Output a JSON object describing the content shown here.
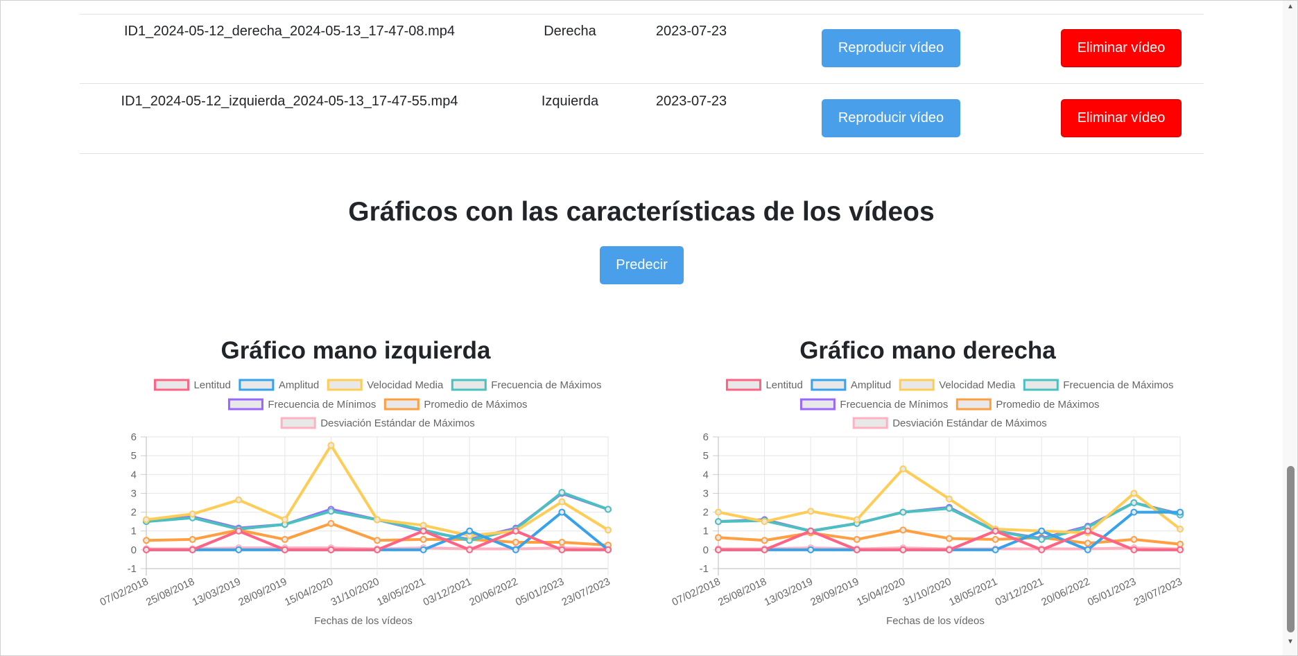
{
  "table": {
    "rows": [
      {
        "file": "ID1_2024-05-12_derecha_2024-05-13_17-47-08.mp4",
        "hand": "Derecha",
        "date": "2023-07-23",
        "play_label": "Reproducir vídeo",
        "delete_label": "Eliminar vídeo"
      },
      {
        "file": "ID1_2024-05-12_izquierda_2024-05-13_17-47-55.mp4",
        "hand": "Izquierda",
        "date": "2023-07-23",
        "play_label": "Reproducir vídeo",
        "delete_label": "Eliminar vídeo"
      }
    ]
  },
  "section": {
    "title": "Gráficos con las características de los vídeos",
    "predict_label": "Predecir"
  },
  "colors": {
    "play_button": "#4a9fea",
    "delete_button": "#ff0000"
  },
  "chart_data": [
    {
      "type": "line",
      "title": "Gráfico mano izquierda",
      "xlabel": "Fechas de los vídeos",
      "ylabel": "",
      "ylim": [
        -1,
        6
      ],
      "yticks": [
        -1,
        0,
        1,
        2,
        3,
        4,
        5,
        6
      ],
      "grid": true,
      "legend_position": "top",
      "categories": [
        "07/02/2018",
        "25/08/2018",
        "13/03/2019",
        "28/09/2019",
        "15/04/2020",
        "31/10/2020",
        "18/05/2021",
        "03/12/2021",
        "20/06/2022",
        "05/01/2023",
        "23/07/2023"
      ],
      "series": [
        {
          "name": "Lentitud",
          "color": "#ff6384",
          "values": [
            0,
            0,
            1,
            0,
            0,
            0,
            1,
            0,
            1,
            0,
            0
          ]
        },
        {
          "name": "Amplitud",
          "color": "#36a2eb",
          "values": [
            0,
            0,
            0,
            0,
            0,
            0,
            0,
            1,
            0,
            2,
            0
          ]
        },
        {
          "name": "Velocidad Media",
          "color": "#ffcd56",
          "values": [
            1.6,
            1.9,
            2.65,
            1.6,
            5.55,
            1.6,
            1.3,
            0.75,
            1.0,
            2.55,
            1.05
          ]
        },
        {
          "name": "Frecuencia de Máximos",
          "color": "#4bc0c0",
          "values": [
            1.5,
            1.7,
            1.1,
            1.35,
            2.05,
            1.6,
            1.05,
            0.5,
            1.1,
            3.05,
            2.15
          ]
        },
        {
          "name": "Frecuencia de Mínimos",
          "color": "#9966ff",
          "values": [
            1.5,
            1.75,
            1.15,
            1.35,
            2.15,
            1.6,
            1.0,
            0.55,
            1.15,
            3.0,
            2.15
          ]
        },
        {
          "name": "Promedio de Máximos",
          "color": "#ff9f40",
          "values": [
            0.5,
            0.55,
            1.05,
            0.55,
            1.4,
            0.5,
            0.55,
            0.55,
            0.4,
            0.4,
            0.25
          ]
        },
        {
          "name": "Desviación Estándar de Máximos",
          "color": "#ffb1c1",
          "values": [
            0.05,
            0.05,
            0.1,
            0.1,
            0.1,
            0.05,
            0.1,
            0.05,
            0.05,
            0.1,
            0.05
          ]
        }
      ]
    },
    {
      "type": "line",
      "title": "Gráfico mano derecha",
      "xlabel": "Fechas de los vídeos",
      "ylabel": "",
      "ylim": [
        -1,
        6
      ],
      "yticks": [
        -1,
        0,
        1,
        2,
        3,
        4,
        5,
        6
      ],
      "grid": true,
      "legend_position": "top",
      "categories": [
        "07/02/2018",
        "25/08/2018",
        "13/03/2019",
        "28/09/2019",
        "15/04/2020",
        "31/10/2020",
        "18/05/2021",
        "03/12/2021",
        "20/06/2022",
        "05/01/2023",
        "23/07/2023"
      ],
      "series": [
        {
          "name": "Lentitud",
          "color": "#ff6384",
          "values": [
            0,
            0,
            1,
            0,
            0,
            0,
            1,
            0,
            1,
            0,
            0
          ]
        },
        {
          "name": "Amplitud",
          "color": "#36a2eb",
          "values": [
            0,
            0,
            0,
            0,
            0,
            0,
            0,
            1,
            0,
            2,
            2
          ]
        },
        {
          "name": "Velocidad Media",
          "color": "#ffcd56",
          "values": [
            2.0,
            1.5,
            2.05,
            1.6,
            4.3,
            2.7,
            1.1,
            1.0,
            0.9,
            3.0,
            1.1
          ]
        },
        {
          "name": "Frecuencia de Máximos",
          "color": "#4bc0c0",
          "values": [
            1.5,
            1.55,
            1.0,
            1.4,
            2.0,
            2.2,
            1.0,
            0.55,
            1.2,
            2.5,
            1.85
          ]
        },
        {
          "name": "Frecuencia de Mínimos",
          "color": "#9966ff",
          "values": [
            1.5,
            1.6,
            1.0,
            1.4,
            2.0,
            2.25,
            1.0,
            0.6,
            1.25,
            2.5,
            1.9
          ]
        },
        {
          "name": "Promedio de Máximos",
          "color": "#ff9f40",
          "values": [
            0.65,
            0.5,
            0.9,
            0.55,
            1.05,
            0.6,
            0.55,
            0.65,
            0.35,
            0.55,
            0.3
          ]
        },
        {
          "name": "Desviación Estándar de Máximos",
          "color": "#ffb1c1",
          "values": [
            0.05,
            0.05,
            0.1,
            0.05,
            0.1,
            0.05,
            0.05,
            0.05,
            0.05,
            0.1,
            0.05
          ]
        }
      ]
    }
  ]
}
